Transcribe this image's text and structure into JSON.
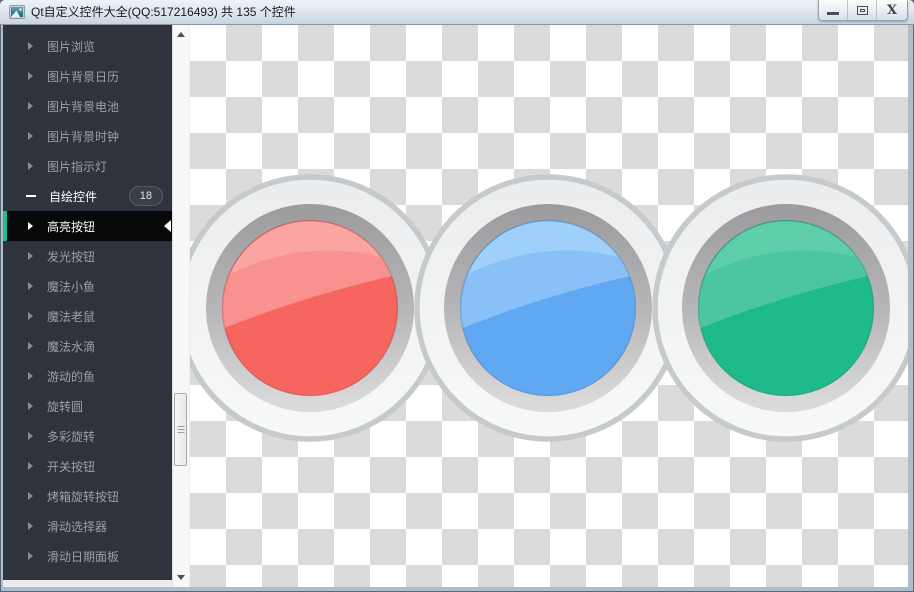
{
  "window": {
    "title": "Qt自定义控件大全(QQ:517216493) 共 135 个控件",
    "app_icon": "photo-icon",
    "close_glyph": "X",
    "controls": [
      {
        "name": "minimize",
        "icon": "minimize-icon"
      },
      {
        "name": "maximize",
        "icon": "maximize-icon"
      },
      {
        "name": "close",
        "icon": "close-icon"
      }
    ]
  },
  "sidebar": {
    "items": [
      {
        "label": "图片浏览",
        "type": "group",
        "state": "collapsed"
      },
      {
        "label": "图片背景日历",
        "type": "group",
        "state": "collapsed"
      },
      {
        "label": "图片背景电池",
        "type": "group",
        "state": "collapsed"
      },
      {
        "label": "图片背景时钟",
        "type": "group",
        "state": "collapsed"
      },
      {
        "label": "图片指示灯",
        "type": "group",
        "state": "collapsed"
      },
      {
        "label": "自绘控件",
        "type": "group",
        "state": "expanded",
        "badge": "18"
      },
      {
        "label": "高亮按钮",
        "type": "item",
        "selected": true
      },
      {
        "label": "发光按钮",
        "type": "item"
      },
      {
        "label": "魔法小鱼",
        "type": "item"
      },
      {
        "label": "魔法老鼠",
        "type": "item"
      },
      {
        "label": "魔法水滴",
        "type": "item"
      },
      {
        "label": "游动的鱼",
        "type": "item"
      },
      {
        "label": "旋转圆",
        "type": "item"
      },
      {
        "label": "多彩旋转",
        "type": "item"
      },
      {
        "label": "开关按钮",
        "type": "item"
      },
      {
        "label": "烤箱旋转按钮",
        "type": "item"
      },
      {
        "label": "滑动选择器",
        "type": "item"
      },
      {
        "label": "滑动日期面板",
        "type": "item"
      }
    ],
    "accent_color": "#19BE93"
  },
  "main": {
    "buttons": [
      {
        "name": "red-highlight-button",
        "base": "#F7655F",
        "gloss": "#F9928F",
        "streak": "#FAA5A2"
      },
      {
        "name": "blue-highlight-button",
        "base": "#61A8F3",
        "gloss": "#88C0F7",
        "streak": "#9ED0FA"
      },
      {
        "name": "green-highlight-button",
        "base": "#1FBA8B",
        "gloss": "#4CC6A1",
        "streak": "#5ECDAA"
      }
    ],
    "colors": {
      "ring_white": "#F1F2F2",
      "ring_edge": "#C7CACD",
      "ring_gray_top": "#9D9DA0",
      "ring_gray_bottom": "#DADADA",
      "checker_light": "#FFFFFF",
      "checker_dark": "#DBDBDB"
    }
  }
}
